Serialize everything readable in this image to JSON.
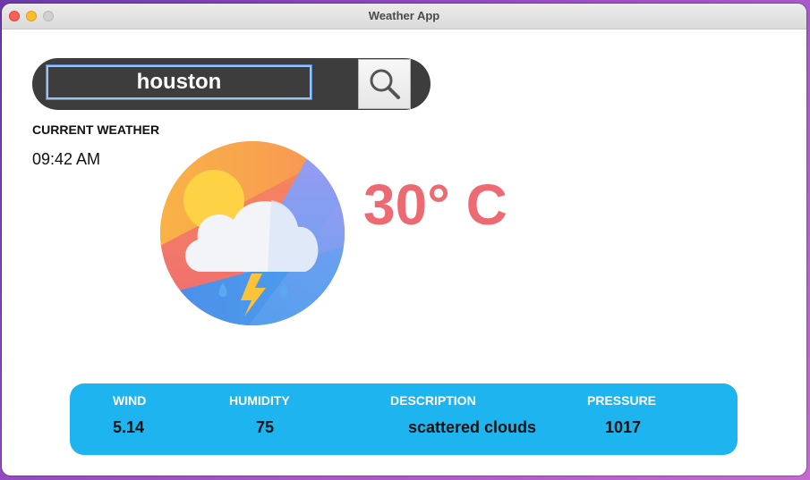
{
  "window": {
    "title": "Weather App"
  },
  "search": {
    "value": "houston"
  },
  "current": {
    "label": "CURRENT WEATHER",
    "time": "09:42 AM",
    "temperature": "30° C"
  },
  "icons": {
    "search": "magnifier-icon",
    "weather": "sun-cloud-thunderstorm-icon"
  },
  "details": {
    "wind_label": "WIND",
    "wind_value": "5.14",
    "humidity_label": "HUMIDITY",
    "humidity_value": "75",
    "description_label": "DESCRIPTION",
    "description_value": "scattered clouds",
    "pressure_label": "PRESSURE",
    "pressure_value": "1017"
  },
  "colors": {
    "accent_panel": "#1db4ef",
    "temperature": "#ee6a72",
    "searchbar": "#3d3d3d"
  }
}
